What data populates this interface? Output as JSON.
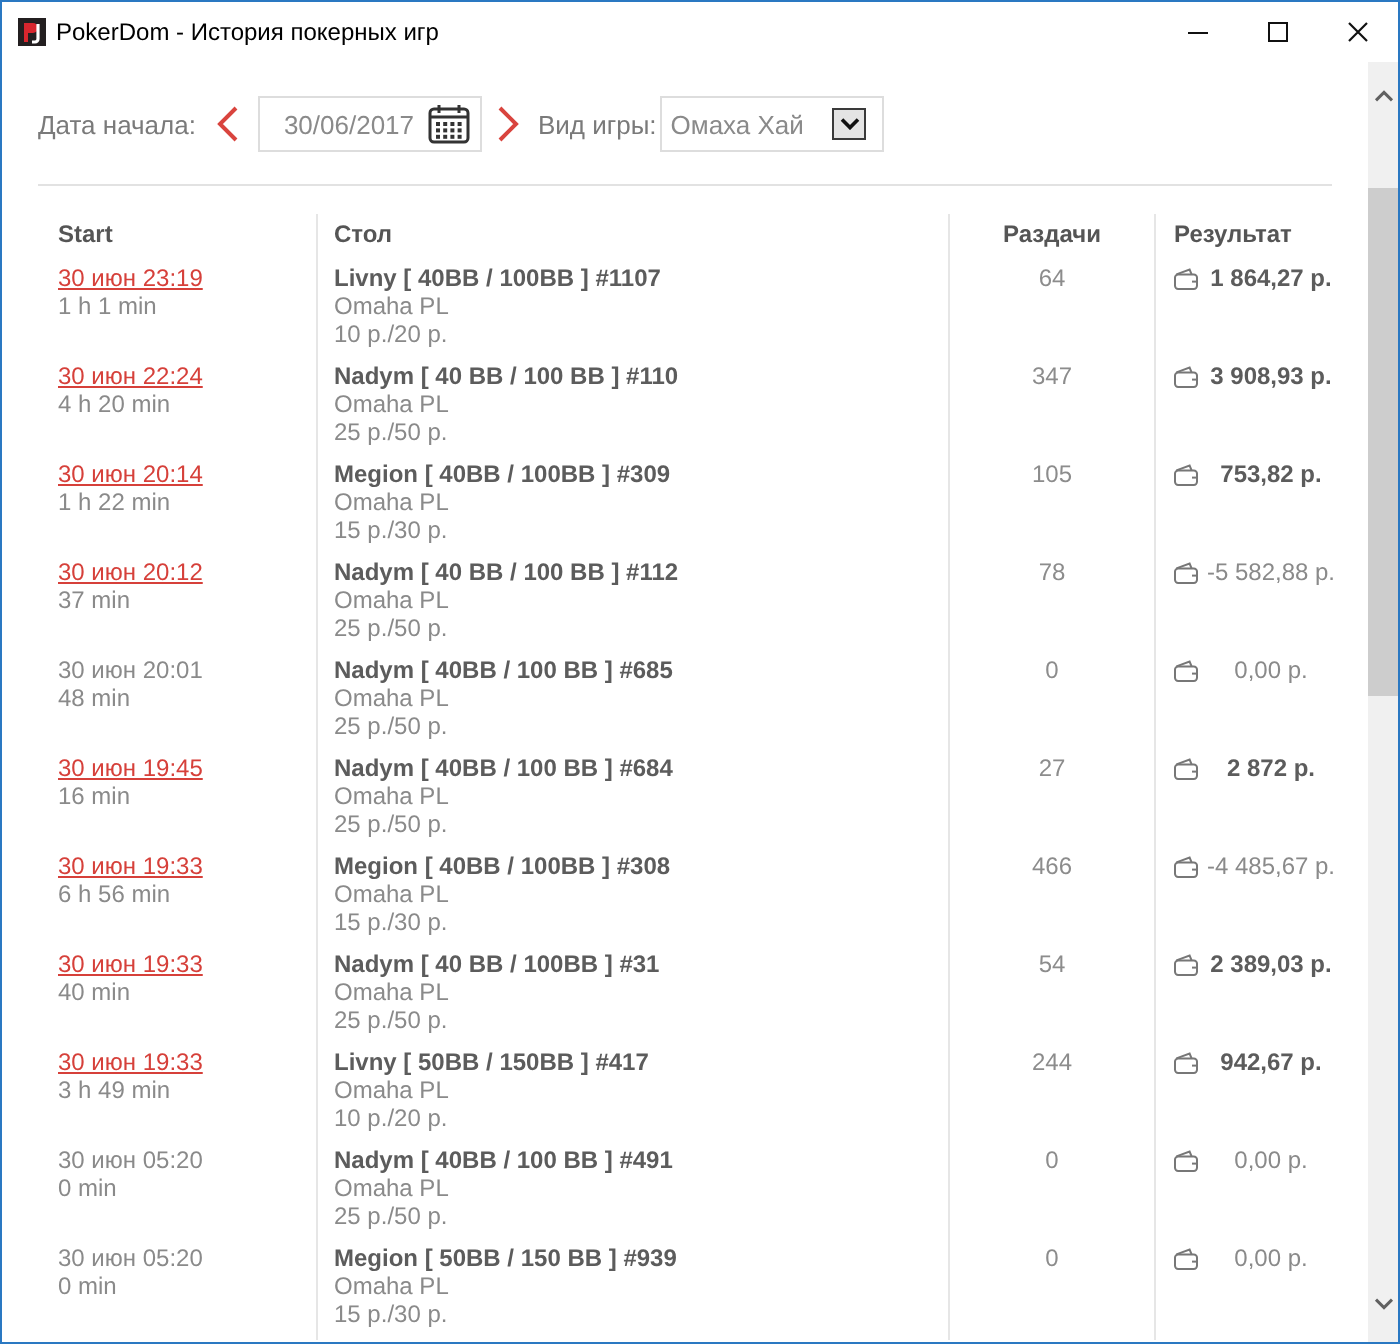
{
  "window": {
    "title": "PokerDom - История покерных игр"
  },
  "filters": {
    "date_label": "Дата начала:",
    "date": {
      "value": "30/06/2017"
    },
    "game_label": "Вид игры:",
    "game": {
      "value": "Омаха Хай"
    }
  },
  "table": {
    "columns": [
      "Start",
      "Стол",
      "Раздачи",
      "Результат"
    ],
    "rows": [
      {
        "start": "30 июн 23:19",
        "linked": true,
        "duration": "1 h 1 min",
        "table": "Livny [ 40BB / 100BB ] #1107",
        "game": "Omaha PL",
        "stakes": "10 р./20 р.",
        "hands": "64",
        "result": "1 864,27 р.",
        "win": true
      },
      {
        "start": "30 июн 22:24",
        "linked": true,
        "duration": "4 h 20 min",
        "table": "Nadym [ 40 BB / 100 BB ] #110",
        "game": "Omaha PL",
        "stakes": "25 р./50 р.",
        "hands": "347",
        "result": "3 908,93 р.",
        "win": true
      },
      {
        "start": "30 июн 20:14",
        "linked": true,
        "duration": "1 h 22 min",
        "table": "Megion [ 40BB / 100BB ] #309",
        "game": "Omaha PL",
        "stakes": "15 р./30 р.",
        "hands": "105",
        "result": "753,82 р.",
        "win": true
      },
      {
        "start": "30 июн 20:12",
        "linked": true,
        "duration": "37 min",
        "table": "Nadym [ 40 BB / 100 BB ] #112",
        "game": "Omaha PL",
        "stakes": "25 р./50 р.",
        "hands": "78",
        "result": "-5 582,88 р.",
        "win": false
      },
      {
        "start": "30 июн 20:01",
        "linked": false,
        "duration": "48 min",
        "table": "Nadym [ 40BB / 100 BB ] #685",
        "game": "Omaha PL",
        "stakes": "25 р./50 р.",
        "hands": "0",
        "result": "0,00 р.",
        "win": false
      },
      {
        "start": "30 июн 19:45",
        "linked": true,
        "duration": "16 min",
        "table": "Nadym [ 40BB / 100 BB ] #684",
        "game": "Omaha PL",
        "stakes": "25 р./50 р.",
        "hands": "27",
        "result": "2 872 р.",
        "win": true
      },
      {
        "start": "30 июн 19:33",
        "linked": true,
        "duration": "6 h 56 min",
        "table": "Megion [ 40BB / 100BB ] #308",
        "game": "Omaha PL",
        "stakes": "15 р./30 р.",
        "hands": "466",
        "result": "-4 485,67 р.",
        "win": false
      },
      {
        "start": "30 июн 19:33",
        "linked": true,
        "duration": "40 min",
        "table": "Nadym [ 40 BB / 100BB ] #31",
        "game": "Omaha PL",
        "stakes": "25 р./50 р.",
        "hands": "54",
        "result": "2 389,03 р.",
        "win": true
      },
      {
        "start": "30 июн 19:33",
        "linked": true,
        "duration": "3 h 49 min",
        "table": "Livny [ 50BB / 150BB ] #417",
        "game": "Omaha PL",
        "stakes": "10 р./20 р.",
        "hands": "244",
        "result": "942,67 р.",
        "win": true
      },
      {
        "start": "30 июн 05:20",
        "linked": false,
        "duration": "0 min",
        "table": "Nadym [ 40BB / 100 BB ] #491",
        "game": "Omaha PL",
        "stakes": "25 р./50 р.",
        "hands": "0",
        "result": "0,00 р.",
        "win": false
      },
      {
        "start": "30 июн 05:20",
        "linked": false,
        "duration": "0 min",
        "table": "Megion [ 50BB / 150 BB ] #939",
        "game": "Omaha PL",
        "stakes": "15 р./30 р.",
        "hands": "0",
        "result": "0,00 р.",
        "win": false
      }
    ]
  }
}
